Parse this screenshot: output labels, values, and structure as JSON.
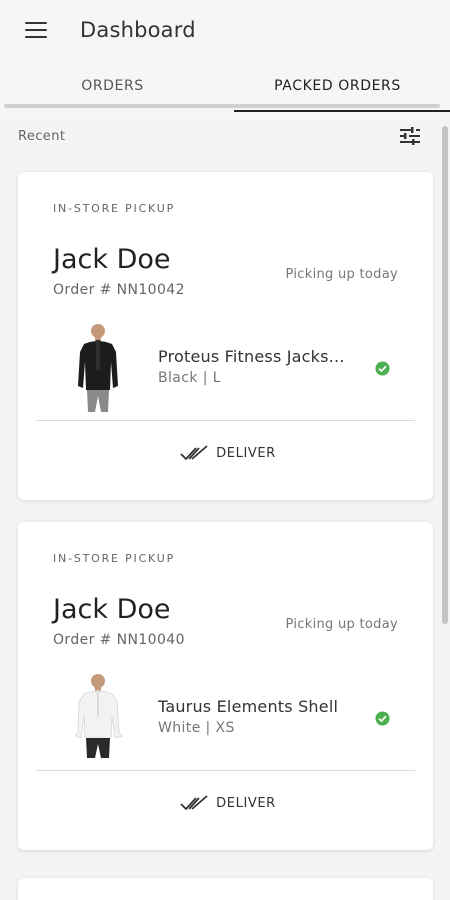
{
  "header": {
    "title": "Dashboard",
    "menu_icon": "hamburger-menu-icon"
  },
  "tabs": [
    {
      "label": "ORDERS",
      "active": false
    },
    {
      "label": "PACKED ORDERS",
      "active": true
    }
  ],
  "list": {
    "section_label": "Recent",
    "filter_icon": "tune-filter-icon"
  },
  "orders": [
    {
      "type": "IN-STORE PICKUP",
      "customer": "Jack Doe",
      "order_number": "Order # NN10042",
      "pickup_status": "Picking up today",
      "product_name": "Proteus Fitness Jacks...",
      "variant": "Black | L",
      "item_status_icon": "check-circle-icon",
      "item_status_color": "#4caf50",
      "product_color": "#1c1c1c",
      "action_label": "DELIVER",
      "action_icon": "double-check-icon"
    },
    {
      "type": "IN-STORE PICKUP",
      "customer": "Jack Doe",
      "order_number": "Order # NN10040",
      "pickup_status": "Picking up today",
      "product_name": "Taurus Elements Shell",
      "variant": "White | XS",
      "item_status_icon": "check-circle-icon",
      "item_status_color": "#4caf50",
      "product_color": "#f2f2f2",
      "action_label": "DELIVER",
      "action_icon": "double-check-icon"
    }
  ]
}
